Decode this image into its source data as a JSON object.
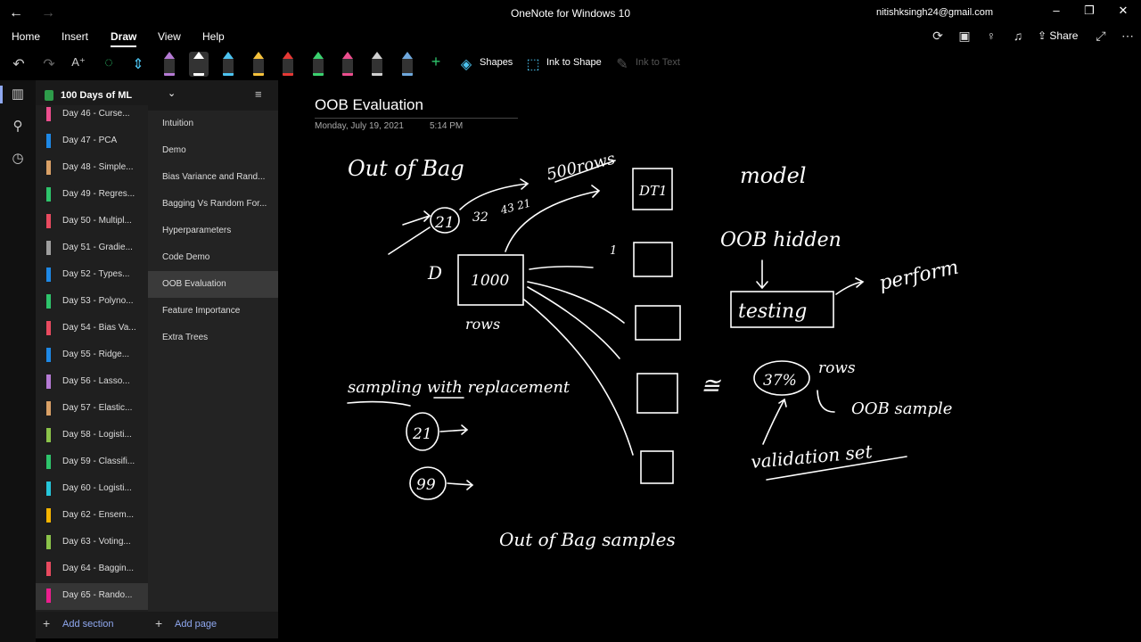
{
  "window": {
    "title": "OneNote for Windows 10",
    "account": "nitishksingh24@gmail.com"
  },
  "menu": [
    "Home",
    "Insert",
    "Draw",
    "View",
    "Help"
  ],
  "menu_active": "Draw",
  "share_label": "Share",
  "toolbar": {
    "shapes_label": "Shapes",
    "ink_to_shape_label": "Ink to Shape",
    "ink_to_text_label": "Ink to Text",
    "pen_colors": [
      "#b57ad4",
      "#ffffff",
      "#4cc3f0",
      "#f5c13c",
      "#e53935",
      "#3bd16f",
      "#ec4e8e",
      "#d0d0d0",
      "#6fa8dc"
    ]
  },
  "notebook": {
    "name": "100 Days of ML",
    "color": "#2e9c4a"
  },
  "sections": [
    {
      "label": "Day 46 - Curse...",
      "color": "#ec4e8e"
    },
    {
      "label": "Day 47 - PCA",
      "color": "#1e88e5"
    },
    {
      "label": "Day 48 - Simple...",
      "color": "#d9a066"
    },
    {
      "label": "Day 49 - Regres...",
      "color": "#2ec46b"
    },
    {
      "label": "Day 50 - Multipl...",
      "color": "#e84a5f"
    },
    {
      "label": "Day 51 - Gradie...",
      "color": "#9e9e9e"
    },
    {
      "label": "Day 52 - Types...",
      "color": "#1e88e5"
    },
    {
      "label": "Day 53 - Polyno...",
      "color": "#2ec46b"
    },
    {
      "label": "Day 54 - Bias Va...",
      "color": "#e84a5f"
    },
    {
      "label": "Day 55 - Ridge...",
      "color": "#1e88e5"
    },
    {
      "label": "Day 56 - Lasso...",
      "color": "#b57ad4"
    },
    {
      "label": "Day 57 - Elastic...",
      "color": "#d9a066"
    },
    {
      "label": "Day 58 - Logisti...",
      "color": "#8bc34a"
    },
    {
      "label": "Day 59 - Classifi...",
      "color": "#2ec46b"
    },
    {
      "label": "Day 60 - Logisti...",
      "color": "#26c6da"
    },
    {
      "label": "Day 62 - Ensem...",
      "color": "#f5b400"
    },
    {
      "label": "Day 63 - Voting...",
      "color": "#8bc34a"
    },
    {
      "label": "Day 64 - Baggin...",
      "color": "#e84a5f"
    },
    {
      "label": "Day 65 - Rando...",
      "color": "#ec1e8e"
    }
  ],
  "active_section_index": 18,
  "pages": [
    "Intuition",
    "Demo",
    "Bias Variance and Rand...",
    "Bagging Vs Random For...",
    "Hyperparameters",
    "Code Demo",
    "OOB Evaluation",
    "Feature Importance",
    "Extra Trees"
  ],
  "active_page_index": 6,
  "add_section_label": "Add section",
  "add_page_label": "Add page",
  "note": {
    "title": "OOB Evaluation",
    "date": "Monday, July 19, 2021",
    "time": "5:14 PM"
  },
  "ink": {
    "out_of_bag": "Out of Bag",
    "rows_500": "500rows",
    "dt1": "DT1",
    "model": "model",
    "num_21": "21",
    "num_32": "32",
    "num_43_21": "43 21",
    "D": "D",
    "n_1000": "1000",
    "rows": "rows",
    "oob_hidden": "OOB hidden",
    "testing": "testing",
    "perform": "perform",
    "sampling": "sampling with replacement",
    "approx": "≅",
    "pct_37": "37%",
    "rows2": "rows",
    "oob_sample": "OOB sample",
    "validation_set": "validation set",
    "circ_21": "21",
    "circ_99": "99",
    "oob_samples": "Out of Bag samples",
    "one": "1"
  }
}
